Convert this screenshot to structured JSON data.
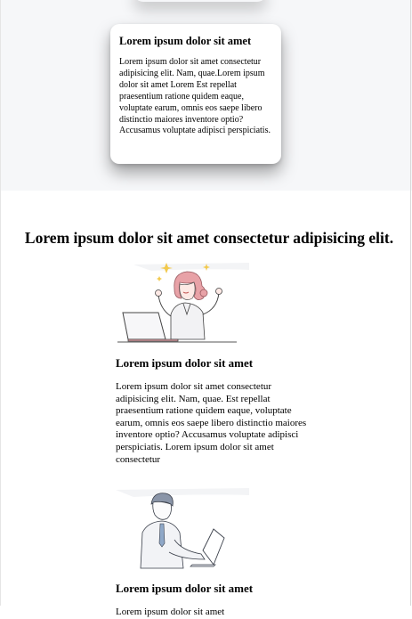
{
  "top_card": {
    "title": "Lorem ipsum dolor sit amet",
    "body": "Lorem ipsum dolor sit amet consectetur adipisicing elit. Nam, quae.Lorem ipsum dolor sit amet Lorem Est repellat praesentium ratione quidem eaque, voluptate earum, omnis eos saepe libero distinctio maiores inventore optio? Accusamus voluptate adipisci perspiciatis."
  },
  "section": {
    "heading": "Lorem ipsum dolor sit amet consectetur adipisicing elit."
  },
  "features": [
    {
      "illustration": "woman-celebrating-laptop-illustration",
      "title": "Lorem ipsum dolor sit amet",
      "body": "Lorem ipsum dolor sit amet consectetur adipisicing elit. Nam, quae. Est repellat praesentium ratione quidem eaque, voluptate earum, omnis eos saepe libero distinctio maiores inventore optio? Accusamus voluptate adipisci perspiciatis. Lorem ipsum dolor sit amet consectetur"
    },
    {
      "illustration": "man-typing-laptop-illustration",
      "title": "Lorem ipsum dolor sit amet",
      "body": "Lorem ipsum dolor sit amet"
    }
  ],
  "colors": {
    "band_background": "#f6f7f9",
    "accent_pink": "#e8a2a7",
    "accent_yellow": "#f2c94c",
    "accent_blue": "#8fa8c8"
  }
}
